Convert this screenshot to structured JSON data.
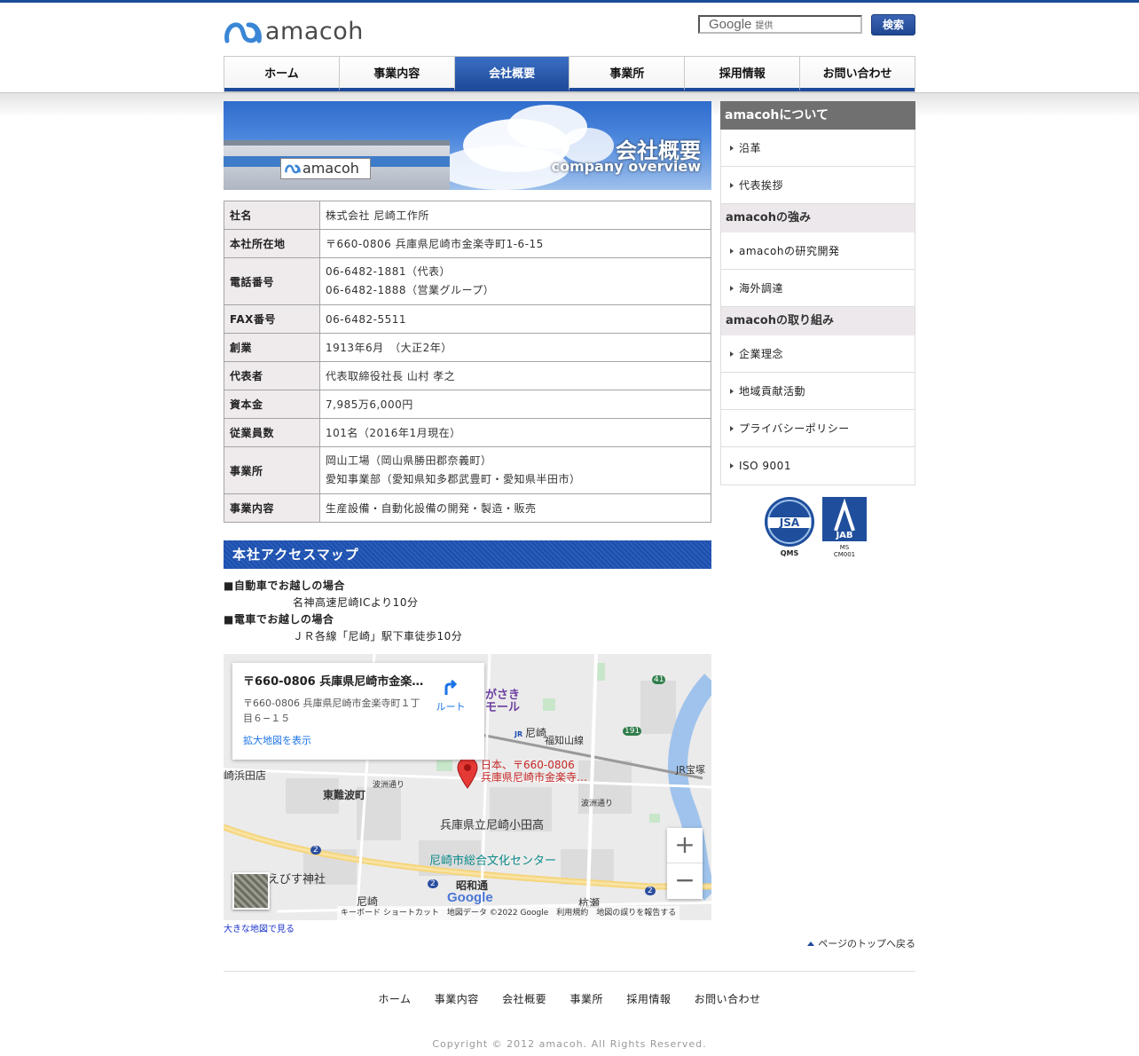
{
  "header": {
    "logo_text": "amacoh",
    "search_brand": "Google",
    "search_provided": "提供",
    "search_button": "検索"
  },
  "nav": [
    "ホーム",
    "事業内容",
    "会社概要",
    "事業所",
    "採用情報",
    "お問い合わせ"
  ],
  "nav_active_index": 2,
  "banner": {
    "title": "会社概要",
    "subtitle": "company overview",
    "sign": "amacoh"
  },
  "company": [
    {
      "label": "社名",
      "value": [
        "株式会社 尼崎工作所"
      ]
    },
    {
      "label": "本社所在地",
      "value": [
        "〒660-0806 兵庫県尼崎市金楽寺町1-6-15"
      ]
    },
    {
      "label": "電話番号",
      "value": [
        "06-6482-1881（代表）",
        "06-6482-1888（営業グループ）"
      ]
    },
    {
      "label": "FAX番号",
      "value": [
        "06-6482-5511"
      ]
    },
    {
      "label": "創業",
      "value": [
        "1913年6月　（大正2年）"
      ]
    },
    {
      "label": "代表者",
      "value": [
        "代表取締役社長 山村 孝之"
      ]
    },
    {
      "label": "資本金",
      "value": [
        "7,985万6,000円"
      ]
    },
    {
      "label": "従業員数",
      "value": [
        "101名（2016年1月現在）"
      ]
    },
    {
      "label": "事業所",
      "value": [
        "岡山工場（岡山県勝田郡奈義町）",
        "愛知事業部（愛知県知多郡武豊町・愛知県半田市）"
      ]
    },
    {
      "label": "事業内容",
      "value": [
        "生産設備・自動化設備の開発・製造・販売"
      ]
    }
  ],
  "access": {
    "heading": "本社アクセスマップ",
    "car_title": "■自動車でお越しの場合",
    "car_text": "名神高速尼崎ICより10分",
    "train_title": "■電車でお越しの場合",
    "train_text": "ＪＲ各線「尼崎」駅下車徒歩10分"
  },
  "map": {
    "card_title": "〒660-0806 兵庫県尼崎市金楽寺町１丁目６−１５",
    "card_address": "〒660-0806 兵庫県尼崎市金楽寺町１丁目６−１５",
    "card_link": "拡大地図を表示",
    "route_label": "ルート",
    "pin_label_1": "日本、〒660-0806",
    "pin_label_2": "兵庫県尼崎市金楽寺…",
    "places": {
      "amagasaki_station": "尼崎",
      "fukuchiyama": "福知山線",
      "higashi_nanba": "東難波町",
      "nanba_dori": "波洲通り",
      "school": "兵庫県立尼崎小田高",
      "culture_center": "尼崎市総合文化センター",
      "ebisu": "えびす神社",
      "showa": "昭和通",
      "hamada": "崎浜田店",
      "mall": "がさき モール",
      "kuise": "杭瀬",
      "jr_takarazuka": "JR宝塚",
      "amagasaki_bottom": "尼崎",
      "route_41": "41",
      "route_191": "191",
      "route_2a": "2",
      "route_2b": "2",
      "route_2c": "2",
      "jr_mark": "JR"
    },
    "google_logo": "Google",
    "footer": "キーボード ショートカット　地図データ ©2022 Google　利用規約　地図の誤りを報告する",
    "zoom_in": "+",
    "zoom_out": "−",
    "large_map_link": "大きな地図で見る"
  },
  "to_top": "ページのトップへ戻る",
  "sidebar": {
    "header": "amacohについて",
    "groups": [
      {
        "title": "",
        "items": [
          "沿革",
          "代表挨拶"
        ]
      },
      {
        "title": "amacohの強み",
        "items": [
          "amacohの研究開発",
          "海外調達"
        ]
      },
      {
        "title": "amacohの取り組み",
        "items": [
          "企業理念",
          "地域貢献活動",
          "プライバシーポリシー",
          "ISO 9001"
        ]
      }
    ],
    "cert_jsa": "JSA",
    "cert_qms": "QMS",
    "cert_jab": "JAB",
    "cert_ms": "MS",
    "cert_cm": "CM001"
  },
  "footer": {
    "links": [
      "ホーム",
      "事業内容",
      "会社概要",
      "事業所",
      "採用情報",
      "お問い合わせ"
    ],
    "copyright": "Copyright © 2012 amacoh. All Rights Reserved."
  },
  "colors": {
    "brand_blue": "#1d4a9a",
    "nav_active": "#2a5bb0",
    "sidebar_header": "#707070",
    "label_bg": "#efeaec"
  }
}
